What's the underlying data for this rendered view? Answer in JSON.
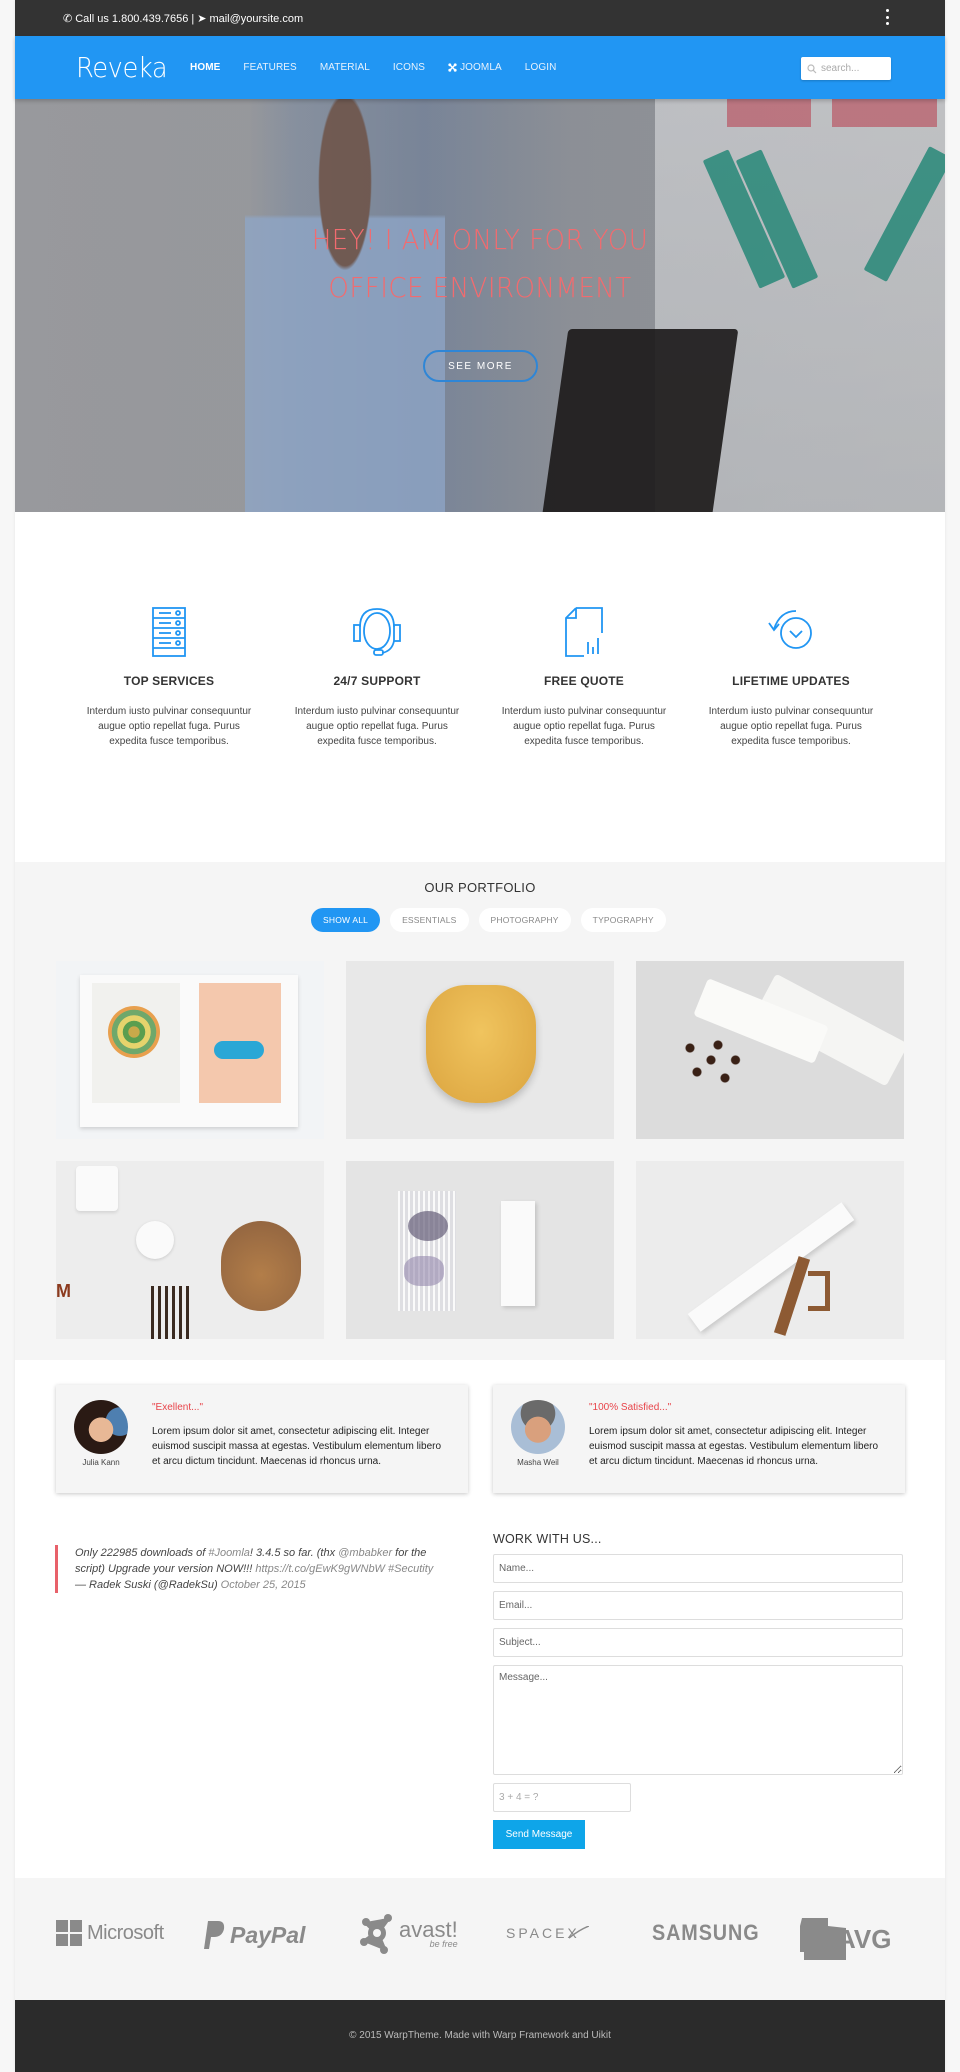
{
  "topbar": {
    "phone_icon": "phone-icon",
    "phone_text": "Call us 1.800.439.7656",
    "separator": "|",
    "mail_icon": "paper-plane-icon",
    "email": "mail@yoursite.com",
    "menu_icon": "kebab-menu-icon"
  },
  "nav": {
    "logo": "Reveka",
    "items": [
      {
        "label": "HOME",
        "active": true
      },
      {
        "label": "FEATURES",
        "active": false
      },
      {
        "label": "MATERIAL",
        "active": false
      },
      {
        "label": "ICONS",
        "active": false
      },
      {
        "label": "JOOMLA",
        "active": false,
        "icon": "joomla-icon"
      },
      {
        "label": "LOGIN",
        "active": false
      }
    ],
    "search_placeholder": "search..."
  },
  "hero": {
    "line1": "HEY! I AM ONLY FOR YOU",
    "line2": "OFFICE ENVIRONMENT",
    "button": "SEE MORE"
  },
  "features": [
    {
      "icon": "server-icon",
      "title": "TOP SERVICES",
      "text": "Interdum iusto pulvinar consequuntur augue optio repellat fuga. Purus expedita fusce temporibus."
    },
    {
      "icon": "headset-icon",
      "title": "24/7 SUPPORT",
      "text": "Interdum iusto pulvinar consequuntur augue optio repellat fuga. Purus expedita fusce temporibus."
    },
    {
      "icon": "document-chart-icon",
      "title": "FREE QUOTE",
      "text": "Interdum iusto pulvinar consequuntur augue optio repellat fuga. Purus expedita fusce temporibus."
    },
    {
      "icon": "clock-refresh-icon",
      "title": "LIFETIME UPDATES",
      "text": "Interdum iusto pulvinar consequuntur augue optio repellat fuga. Purus expedita fusce temporibus."
    }
  ],
  "portfolio": {
    "title": "OUR PORTFOLIO",
    "filters": [
      {
        "label": "SHOW ALL",
        "active": true
      },
      {
        "label": "ESSENTIALS",
        "active": false
      },
      {
        "label": "PHOTOGRAPHY",
        "active": false
      },
      {
        "label": "TYPOGRAPHY",
        "active": false
      }
    ],
    "items": [
      {
        "subject": "open illustrated book"
      },
      {
        "subject": "yellow chair seat"
      },
      {
        "subject": "coffee bags with beans"
      },
      {
        "subject": "tea kettle and pencils"
      },
      {
        "subject": "layered glass sculpture with card"
      },
      {
        "subject": "tablet on wooden stand"
      }
    ]
  },
  "testimonials": [
    {
      "name": "Julia Kann",
      "quote": "\"Exellent...\"",
      "text": "Lorem ipsum dolor sit amet, consectetur adipiscing elit. Integer euismod suscipit massa at egestas. Vestibulum elementum libero et arcu dictum tincidunt. Maecenas id rhoncus urna."
    },
    {
      "name": "Masha Weil",
      "quote": "\"100% Satisfied...\"",
      "text": "Lorem ipsum dolor sit amet, consectetur adipiscing elit. Integer euismod suscipit massa at egestas. Vestibulum elementum libero et arcu dictum tincidunt. Maecenas id rhoncus urna."
    }
  ],
  "tweet": {
    "part1": "Only 222985 downloads of ",
    "hashtag1": "#Joomla",
    "part2": "! 3.4.5 so far. (thx ",
    "mention": "@mbabker",
    "part3": " for the script) Upgrade your version NOW!!! ",
    "link": "https://t.co/gEwK9gWNbW",
    "part4": " ",
    "hashtag2": "#Secutity",
    "author": "— Radek Suski (@RadekSu) ",
    "date": "October 25, 2015"
  },
  "contact": {
    "title": "WORK WITH US...",
    "name_placeholder": "Name...",
    "email_placeholder": "Email...",
    "subject_placeholder": "Subject...",
    "message_placeholder": "Message...",
    "captcha_placeholder": "3 + 4 = ?",
    "send_label": "Send Message"
  },
  "logos": [
    {
      "name": "Microsoft",
      "icon": "microsoft-logo-icon"
    },
    {
      "name": "PayPal",
      "icon": "paypal-logo-icon"
    },
    {
      "name": "avast!",
      "tagline": "be free",
      "icon": "avast-logo-icon"
    },
    {
      "name": "SPACEX",
      "icon": "spacex-logo-icon"
    },
    {
      "name": "SAMSUNG",
      "icon": "samsung-logo-icon"
    },
    {
      "name": "AVG",
      "icon": "avg-logo-icon"
    }
  ],
  "footer": {
    "text": "© 2015 WarpTheme. Made with Warp Framework and Uikit"
  },
  "colors": {
    "brand_blue": "#2196f3",
    "hero_text": "#f26b6f",
    "quote_red": "#e8444a",
    "send_button": "#0ea5e9",
    "topbar": "#333333",
    "footer": "#2b2b2b"
  }
}
